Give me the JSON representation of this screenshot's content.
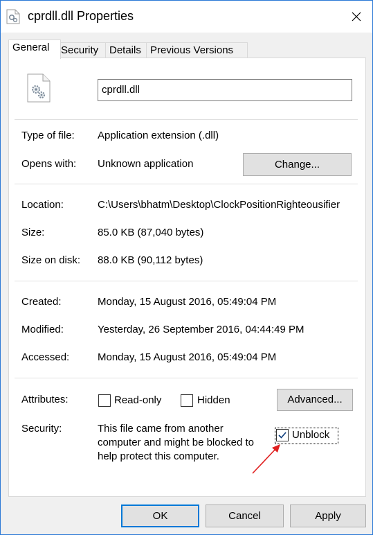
{
  "window": {
    "title": "cprdll.dll Properties",
    "close_icon": "close-icon"
  },
  "tabs": [
    {
      "label": "General",
      "active": true
    },
    {
      "label": "Security",
      "active": false
    },
    {
      "label": "Details",
      "active": false
    },
    {
      "label": "Previous Versions",
      "active": false
    }
  ],
  "general": {
    "file_name": "cprdll.dll",
    "type_label": "Type of file:",
    "type_value": "Application extension (.dll)",
    "opens_label": "Opens with:",
    "opens_value": "Unknown application",
    "change_button": "Change...",
    "location_label": "Location:",
    "location_value": "C:\\Users\\bhatm\\Desktop\\ClockPositionRighteousifier",
    "size_label": "Size:",
    "size_value": "85.0 KB (87,040 bytes)",
    "size_on_disk_label": "Size on disk:",
    "size_on_disk_value": "88.0 KB (90,112 bytes)",
    "created_label": "Created:",
    "created_value": "Monday, 15 August 2016, 05:49:04 PM",
    "modified_label": "Modified:",
    "modified_value": "Yesterday, 26 September 2016, 04:44:49 PM",
    "accessed_label": "Accessed:",
    "accessed_value": "Monday, 15 August 2016, 05:49:04 PM",
    "attributes_label": "Attributes:",
    "readonly_label": "Read-only",
    "readonly_checked": false,
    "hidden_label": "Hidden",
    "hidden_checked": false,
    "advanced_button": "Advanced...",
    "security_label": "Security:",
    "security_text_line1": "This file came from another",
    "security_text_line2": "computer and might be blocked to",
    "security_text_line3": "help protect this computer.",
    "unblock_label": "Unblock",
    "unblock_checked": true,
    "arrow_color": "#e02020"
  },
  "footer": {
    "ok": "OK",
    "cancel": "Cancel",
    "apply": "Apply"
  },
  "colors": {
    "accent": "#0078d7",
    "window_border": "#2b79d6"
  }
}
